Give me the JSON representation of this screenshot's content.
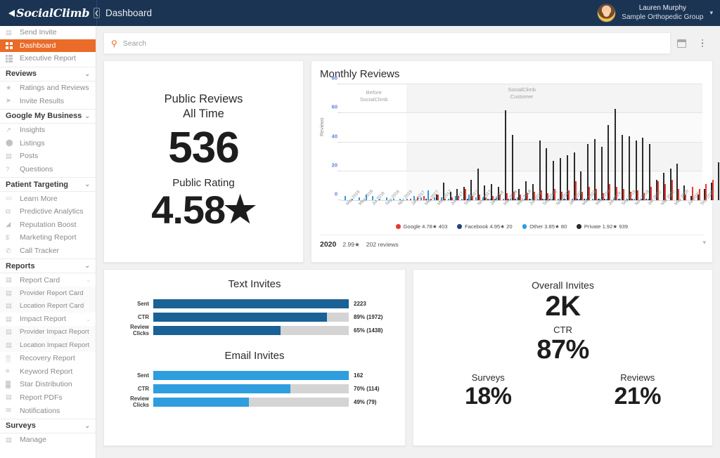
{
  "brand": {
    "name": "SocialClimb",
    "collapse_icon": "chevron-left-icon"
  },
  "header": {
    "title": "Dashboard",
    "user": {
      "name": "Lauren Murphy",
      "org": "Sample Orthopedic Group",
      "caret": "chevron-down-icon"
    }
  },
  "search": {
    "placeholder": "Search",
    "value": "",
    "icon": "search-icon"
  },
  "toolbar": {
    "calendar_icon": "calendar-icon",
    "more_icon": "more-vertical-icon"
  },
  "sidebar": {
    "top_items": [
      {
        "label": "Send Invite",
        "icon": "comment-icon",
        "active": false
      },
      {
        "label": "Dashboard",
        "icon": "dashboard-grid-icon",
        "active": true
      },
      {
        "label": "Executive Report",
        "icon": "list-grid-icon",
        "active": false
      }
    ],
    "sections": [
      {
        "label": "Reviews",
        "chevron": "chevron-down-icon",
        "items": [
          {
            "label": "Ratings and Reviews",
            "icon": "star-icon"
          },
          {
            "label": "Invite Results",
            "icon": "send-icon"
          }
        ]
      },
      {
        "label": "Google My Business",
        "chevron": "chevron-down-icon",
        "items": [
          {
            "label": "Insights",
            "icon": "chart-line-icon"
          },
          {
            "label": "Listings",
            "icon": "map-pin-icon"
          },
          {
            "label": "Posts",
            "icon": "post-icon"
          },
          {
            "label": "Questions",
            "icon": "question-circle-icon"
          }
        ]
      },
      {
        "label": "Patient Targeting",
        "chevron": "chevron-down-icon",
        "items": [
          {
            "label": "Learn More",
            "icon": "badge-new-icon"
          },
          {
            "label": "Predictive Analytics",
            "icon": "layers-icon"
          },
          {
            "label": "Reputation Boost",
            "icon": "boost-icon"
          },
          {
            "label": "Marketing Report",
            "icon": "dollar-circle-icon"
          },
          {
            "label": "Call Tracker",
            "icon": "phone-icon"
          }
        ]
      },
      {
        "label": "Reports",
        "chevron": "chevron-down-icon",
        "items": [
          {
            "label": "Report Card",
            "icon": "report-card-icon",
            "caret": "chevron-down-icon"
          },
          {
            "label": "Provider Report Card",
            "icon": "person-card-icon",
            "sub": true
          },
          {
            "label": "Location Report Card",
            "icon": "location-card-icon",
            "sub": true
          },
          {
            "label": "Impact Report",
            "icon": "impact-card-icon",
            "caret": "chevron-down-icon"
          },
          {
            "label": "Provider Impact Report",
            "icon": "person-card-icon",
            "sub": true
          },
          {
            "label": "Location Impact Report",
            "icon": "location-card-icon",
            "sub": true
          },
          {
            "label": "Recovery Report",
            "icon": "bar-chart-icon"
          },
          {
            "label": "Keyword Report",
            "icon": "keyword-list-icon"
          },
          {
            "label": "Star Distribution",
            "icon": "star-bars-icon"
          },
          {
            "label": "Report PDFs",
            "icon": "pdf-icon"
          },
          {
            "label": "Notifications",
            "icon": "envelope-icon"
          }
        ]
      },
      {
        "label": "Surveys",
        "chevron": "chevron-down-icon",
        "items": [
          {
            "label": "Manage",
            "icon": "clipboard-icon"
          }
        ]
      }
    ]
  },
  "public_reviews": {
    "title_line1": "Public Reviews",
    "title_line2": "All Time",
    "count": "536",
    "rating_label": "Public Rating",
    "rating_value": "4.58",
    "star_glyph": "★"
  },
  "colors": {
    "brand_navy": "#1b3453",
    "accent_orange": "#eb6b29",
    "google_red": "#e8392f",
    "facebook_navy": "#28437a",
    "other_blue": "#2e9ede",
    "private_black": "#2b2b2b",
    "text_bar_blue": "#1a6196",
    "email_bar_blue": "#2e9ede",
    "bar_track_gray": "#d4d4d4"
  },
  "chart_data": {
    "type": "bar",
    "title": "Monthly Reviews",
    "xlabel": "",
    "ylabel": "Reviews",
    "ylim": [
      0,
      80
    ],
    "yticks": [
      0,
      20,
      40,
      60,
      80
    ],
    "grid": true,
    "legend_position": "bottom",
    "annotations": [
      {
        "text": "Before SocialClimb",
        "region": "pre-customer"
      },
      {
        "text": "SocialClimb Customer",
        "region": "customer"
      }
    ],
    "customer_start_index": 10,
    "categories": [
      "Mar 2016",
      "Apr 2016",
      "May 2016",
      "Jun 2016",
      "Jul 2016",
      "Aug 2016",
      "Sep 2016",
      "Oct 2016",
      "Nov 2016",
      "Dec 2016",
      "Jan 2017",
      "Feb 2017",
      "Mar 2017",
      "Apr 2017",
      "May 2017",
      "Jun 2017",
      "Jul 2017",
      "Aug 2017",
      "Sep 2017",
      "Oct 2017",
      "Nov 2017",
      "Dec 2017",
      "Jan 2018",
      "Feb 2018",
      "Mar 2018",
      "Apr 2018",
      "May 2018",
      "Jun 2018",
      "Jul 2018",
      "Aug 2018",
      "Sep 2018",
      "Oct 2018",
      "Nov 2018",
      "Dec 2018",
      "Jan 2019",
      "Feb 2019",
      "Mar 2019",
      "Apr 2019",
      "May 2019",
      "Jun 2019",
      "Jul 2019",
      "Aug 2019",
      "Sep 2019",
      "Oct 2019",
      "Nov 2019",
      "Dec 2019",
      "Jan 2020",
      "Feb 2020",
      "Mar 2020",
      "Apr 2020",
      "May 2020",
      "Jun 2020",
      "Jul 2020",
      "Aug 2020",
      "Sep 2020"
    ],
    "xtick_labels": [
      "Mar 2016",
      "May 2016",
      "Jul 2016",
      "Sep 2016",
      "Nov 2016",
      "Jan 2017",
      "Mar 2017",
      "May 2017",
      "Jul 2017",
      "Sep 2017",
      "Nov 2017",
      "Jan 2018",
      "Mar 2018",
      "May 2018",
      "Jul 2018",
      "Sep 2018",
      "Nov 2018",
      "Jan 2019",
      "Mar 2019",
      "May 2019",
      "Jul 2019",
      "Sep 2019",
      "Nov 2019",
      "Jan 2020",
      "Mar 2020",
      "May 2020",
      "Jul 2020",
      "Sep 2020"
    ],
    "series": [
      {
        "name": "Google",
        "color": "#e8392f",
        "rating": "4.78",
        "total": "403",
        "legend_label": "Google 4.78★ 403",
        "values": [
          0,
          0,
          0,
          0,
          0,
          0,
          0,
          0,
          0,
          0,
          1,
          2,
          3,
          1,
          4,
          1,
          2,
          3,
          8,
          3,
          4,
          2,
          3,
          4,
          5,
          6,
          4,
          5,
          6,
          7,
          5,
          8,
          6,
          7,
          13,
          6,
          9,
          8,
          5,
          11,
          9,
          8,
          6,
          7,
          5,
          9,
          13,
          11,
          14,
          8,
          4,
          9,
          8,
          11,
          14
        ]
      },
      {
        "name": "Facebook",
        "color": "#28437a",
        "rating": "4.95",
        "total": "20",
        "legend_label": "Facebook 4.95★ 20",
        "values": [
          0,
          0,
          0,
          0,
          0,
          0,
          0,
          0,
          0,
          0,
          0,
          0,
          1,
          0,
          0,
          0,
          0,
          0,
          1,
          0,
          0,
          1,
          1,
          0,
          1,
          1,
          0,
          1,
          0,
          1,
          1,
          0,
          1,
          0,
          1,
          1,
          0,
          1,
          1,
          0,
          1,
          0,
          1,
          0,
          1,
          0,
          0,
          0,
          0,
          0,
          0,
          0,
          0,
          0,
          0
        ]
      },
      {
        "name": "Other",
        "color": "#2e9ede",
        "rating": "3.85",
        "total": "80",
        "legend_label": "Other 3.85★ 80",
        "values": [
          3,
          1,
          2,
          4,
          3,
          1,
          2,
          1,
          1,
          1,
          3,
          2,
          7,
          2,
          2,
          1,
          3,
          1,
          4,
          2,
          2,
          1,
          2,
          1,
          1,
          2,
          1,
          1,
          1,
          1,
          1,
          1,
          1,
          1,
          1,
          1,
          1,
          1,
          1,
          1,
          1,
          1,
          1,
          1,
          1,
          0,
          0,
          0,
          0,
          0,
          0,
          0,
          0,
          0,
          0
        ]
      },
      {
        "name": "Private",
        "color": "#2b2b2b",
        "rating": "1.92",
        "total": "939",
        "legend_label": "Private 1.92★ 939",
        "values": [
          0,
          0,
          0,
          0,
          0,
          0,
          0,
          0,
          0,
          0,
          0,
          0,
          0,
          4,
          12,
          6,
          8,
          9,
          14,
          22,
          10,
          11,
          9,
          62,
          45,
          8,
          13,
          11,
          41,
          36,
          27,
          29,
          31,
          33,
          20,
          39,
          42,
          37,
          52,
          63,
          45,
          44,
          41,
          43,
          39,
          14,
          19,
          22,
          25,
          10,
          3,
          4,
          8,
          12,
          26
        ]
      }
    ],
    "footer": {
      "year": "2020",
      "rating": "2.99★",
      "reviews": "202 reviews"
    }
  },
  "text_invites": {
    "type": "bar",
    "title": "Text Invites",
    "bar_color": "#1a6196",
    "rows": [
      {
        "label": "Sent",
        "pct": 100,
        "value": "2223"
      },
      {
        "label": "CTR",
        "pct": 89,
        "value": "89% (1972)"
      },
      {
        "label": "Review Clicks",
        "pct": 65,
        "value": "65% (1438)"
      }
    ]
  },
  "email_invites": {
    "type": "bar",
    "title": "Email Invites",
    "bar_color": "#2e9ede",
    "rows": [
      {
        "label": "Sent",
        "pct": 100,
        "value": "162"
      },
      {
        "label": "CTR",
        "pct": 70,
        "value": "70% (114)"
      },
      {
        "label": "Review Clicks",
        "pct": 49,
        "value": "49% (79)"
      }
    ]
  },
  "overall_invites": {
    "title": "Overall Invites",
    "total": "2K",
    "ctr_label": "CTR",
    "ctr_value": "87%",
    "surveys_label": "Surveys",
    "surveys_value": "18%",
    "reviews_label": "Reviews",
    "reviews_value": "21%"
  }
}
